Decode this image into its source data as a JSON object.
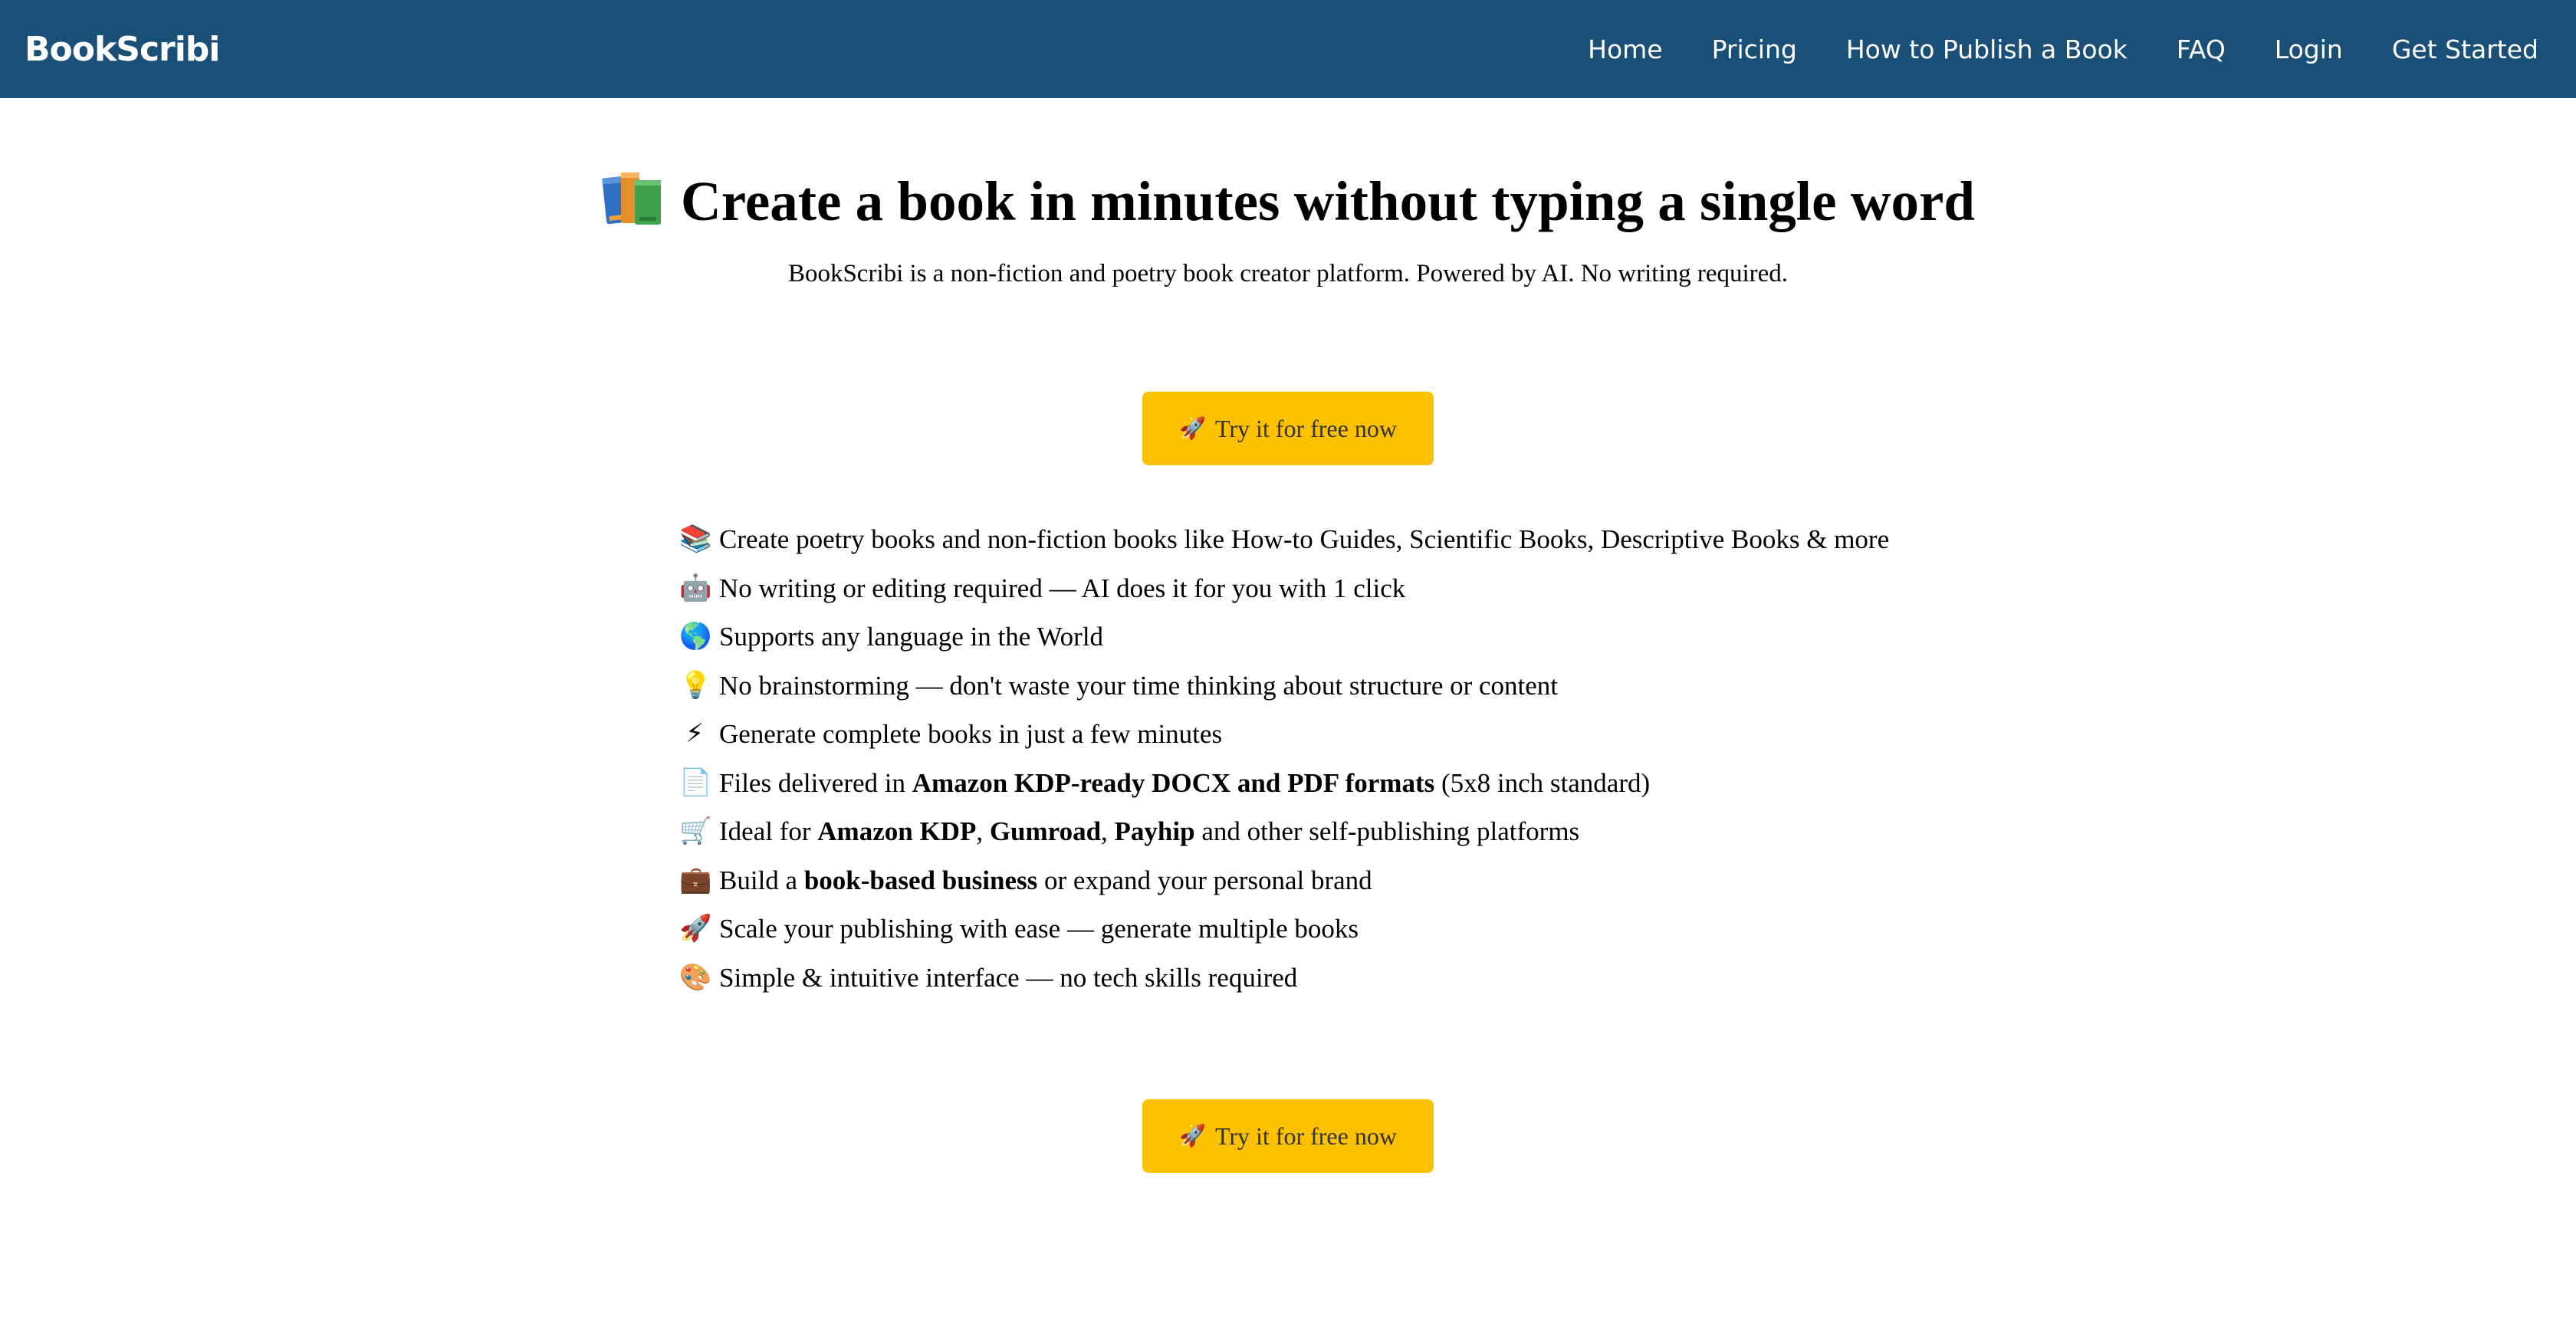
{
  "nav": {
    "brand": "BookScribi",
    "links": [
      "Home",
      "Pricing",
      "How to Publish a Book",
      "FAQ",
      "Login",
      "Get Started"
    ]
  },
  "hero": {
    "title": "Create a book in minutes without typing a single word",
    "subtitle": "BookScribi is a non-fiction and poetry book creator platform. Powered by AI. No writing required."
  },
  "cta": {
    "label": "Try it for free now",
    "icon": "🚀"
  },
  "features": [
    {
      "icon": "📚",
      "parts": [
        "Create poetry books and non-fiction books like How-to Guides, Scientific Books, Descriptive Books & more"
      ]
    },
    {
      "icon": "🤖",
      "parts": [
        "No writing or editing required — AI does it for you with 1 click"
      ]
    },
    {
      "icon": "🌎",
      "parts": [
        "Supports any language in the World"
      ]
    },
    {
      "icon": "💡",
      "parts": [
        "No brainstorming — don't waste your time thinking about structure or content"
      ]
    },
    {
      "icon": "⚡",
      "parts": [
        "Generate complete books in just a few minutes"
      ]
    },
    {
      "icon": "📄",
      "parts": [
        "Files delivered in ",
        "Amazon KDP-ready DOCX and PDF formats",
        " (5x8 inch standard)"
      ]
    },
    {
      "icon": "🛒",
      "parts": [
        "Ideal for ",
        "Amazon KDP",
        ", ",
        "Gumroad",
        ", ",
        "Payhip",
        " and other self-publishing platforms"
      ]
    },
    {
      "icon": "💼",
      "parts": [
        "Build a ",
        "book-based business",
        " or expand your personal brand"
      ]
    },
    {
      "icon": "🚀",
      "parts": [
        "Scale your publishing with ease — generate multiple books"
      ]
    },
    {
      "icon": "🎨",
      "parts": [
        "Simple & intuitive interface — no tech skills required"
      ]
    }
  ],
  "colors": {
    "navbar": "#1a4f78",
    "button": "#fdc100",
    "button_text": "#333333"
  }
}
